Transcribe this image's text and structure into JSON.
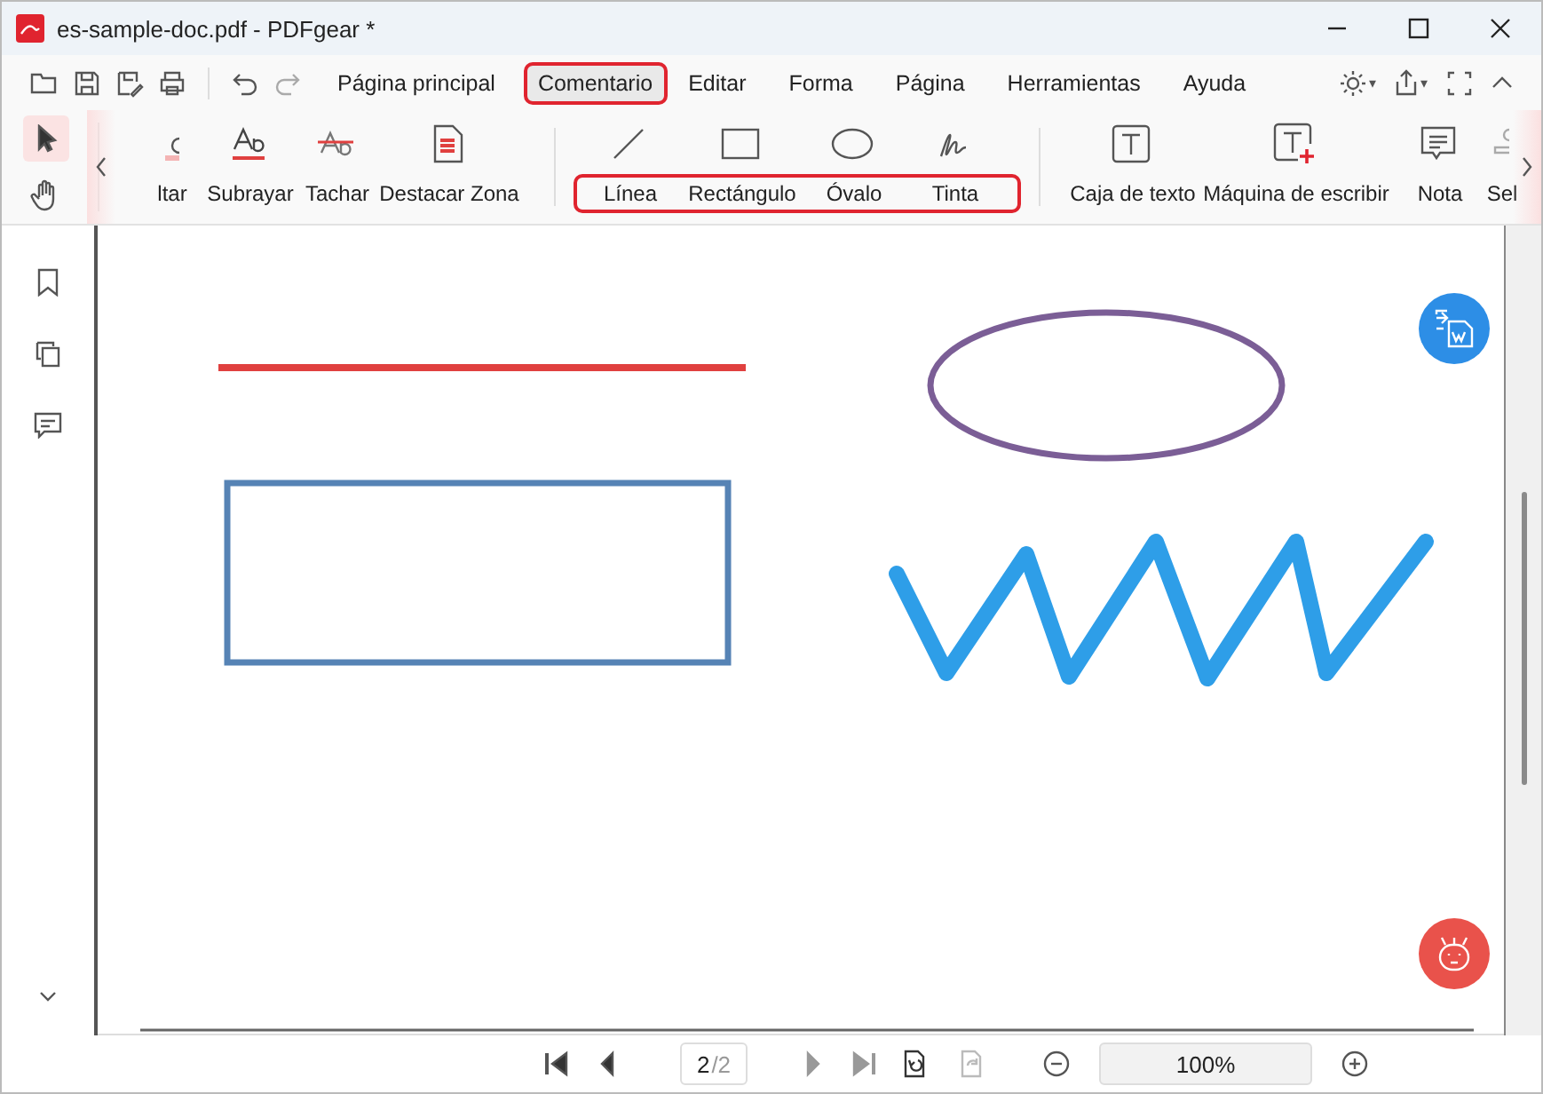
{
  "window": {
    "title": "es-sample-doc.pdf - PDFgear *"
  },
  "menu": [
    {
      "label": "Página principal",
      "selected": false,
      "highlighted": false
    },
    {
      "label": "Comentario",
      "selected": true,
      "highlighted": true
    },
    {
      "label": "Editar",
      "selected": false,
      "highlighted": false
    },
    {
      "label": "Forma",
      "selected": false,
      "highlighted": false
    },
    {
      "label": "Página",
      "selected": false,
      "highlighted": false
    },
    {
      "label": "Herramientas",
      "selected": false,
      "highlighted": false
    },
    {
      "label": "Ayuda",
      "selected": false,
      "highlighted": false
    }
  ],
  "pointer_tools": [
    {
      "kind": "select",
      "selected": true
    },
    {
      "kind": "hand",
      "selected": false
    }
  ],
  "ribbon_groups": [
    {
      "highlighted": false,
      "tools": [
        {
          "label": "ltar",
          "kind": "highlight"
        },
        {
          "label": "Subrayar",
          "kind": "underline"
        },
        {
          "label": "Tachar",
          "kind": "strike"
        },
        {
          "label": "Destacar Zona",
          "kind": "area"
        }
      ]
    },
    {
      "highlighted": true,
      "tools": [
        {
          "label": "Línea",
          "kind": "line"
        },
        {
          "label": "Rectángulo",
          "kind": "rect"
        },
        {
          "label": "Óvalo",
          "kind": "oval"
        },
        {
          "label": "Tinta",
          "kind": "ink"
        }
      ]
    },
    {
      "highlighted": false,
      "tools": [
        {
          "label": "Caja de texto",
          "kind": "textbox"
        },
        {
          "label": "Máquina de escribir",
          "kind": "typewriter"
        },
        {
          "label": "Nota",
          "kind": "note"
        },
        {
          "label": "Sel",
          "kind": "stamp"
        }
      ]
    }
  ],
  "annotations": [
    {
      "kind": "line",
      "color": "#e0403f"
    },
    {
      "kind": "oval",
      "color": "#7b5e96"
    },
    {
      "kind": "rect",
      "color": "#5683b5"
    },
    {
      "kind": "ink",
      "color": "#2e9ee8"
    }
  ],
  "navigation": {
    "current_page": "2",
    "total_pages": "/2",
    "zoom": "100%"
  }
}
